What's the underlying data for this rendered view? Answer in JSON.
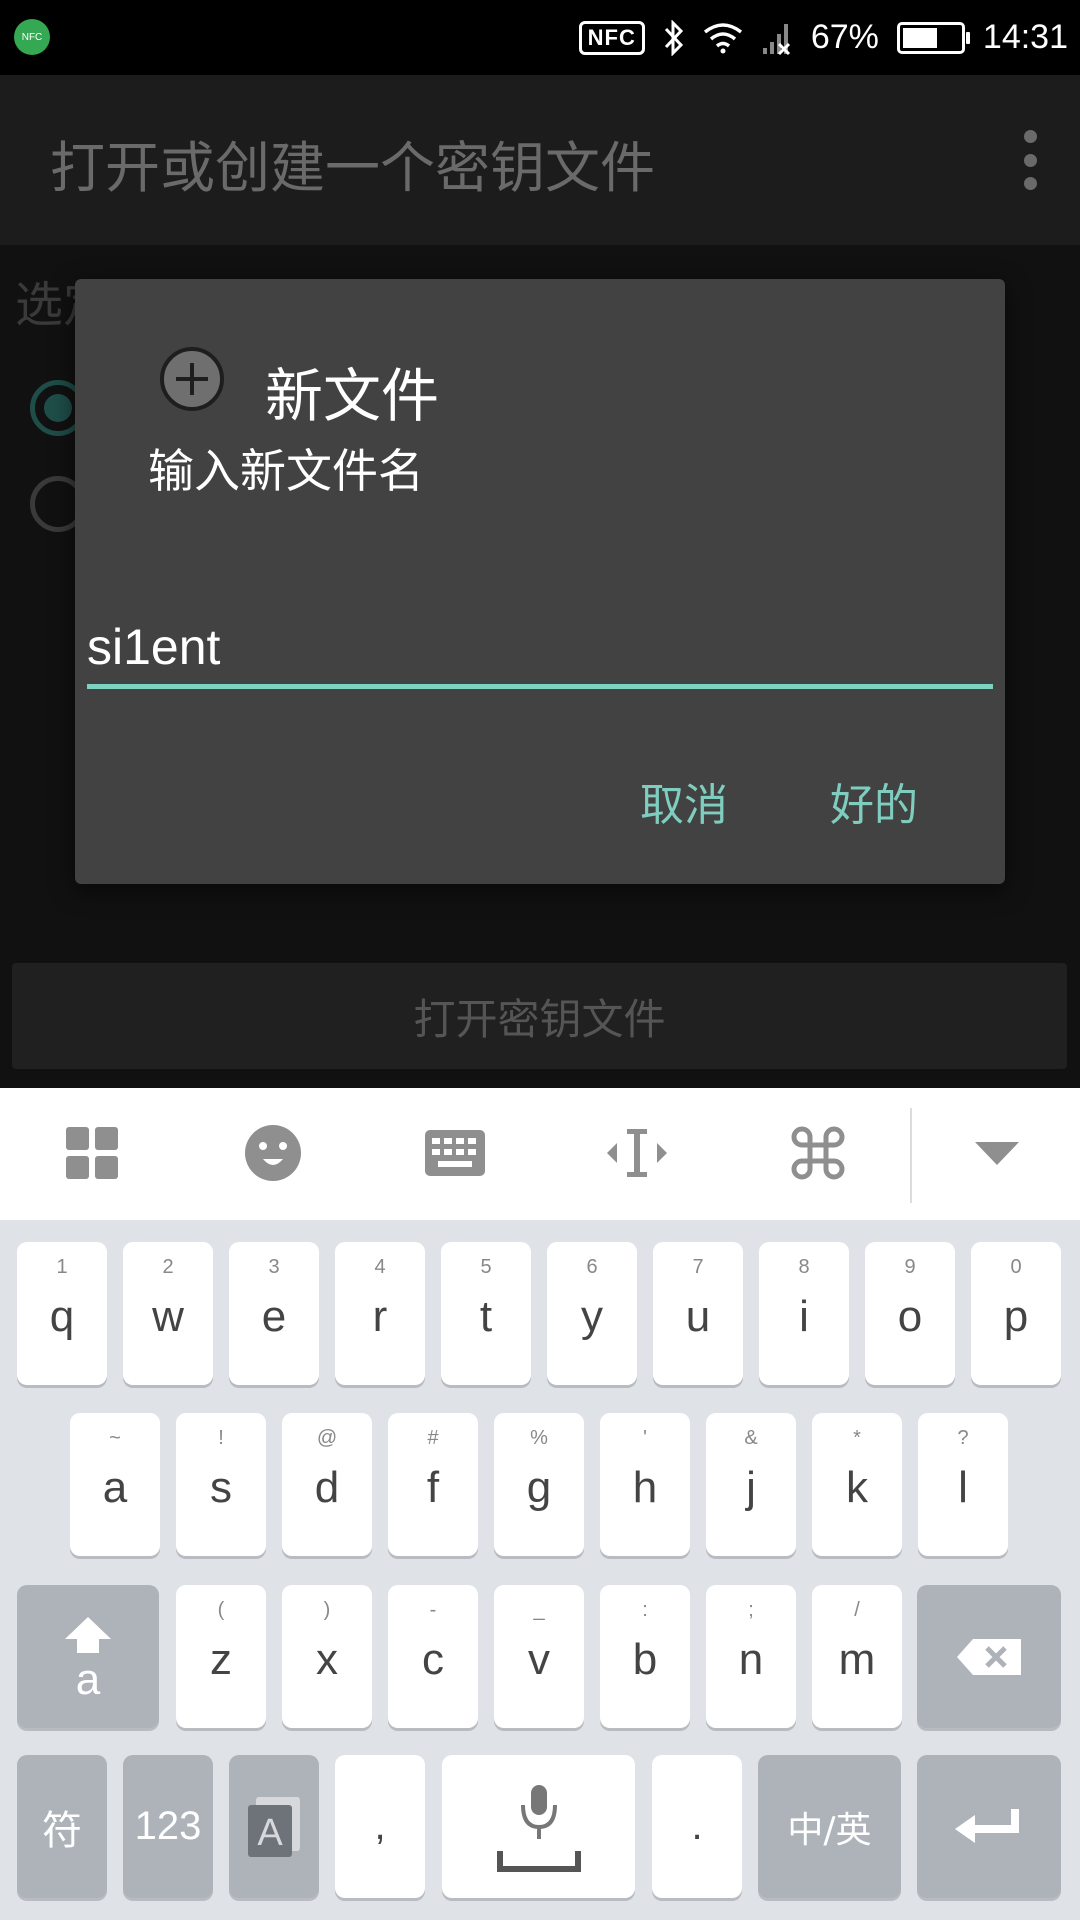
{
  "status_bar": {
    "nfc_badge": "NFC",
    "nfc_box": "NFC",
    "battery_percent": "67%",
    "battery_level": 0.67,
    "time": "14:31"
  },
  "app_bar": {
    "title": "打开或创建一个密钥文件"
  },
  "background": {
    "section_label": "选定一个文件",
    "open_button": "打开密钥文件"
  },
  "dialog": {
    "title": "新文件",
    "message": "输入新文件名",
    "input_value": "si1ent",
    "cancel_label": "取消",
    "ok_label": "好的"
  },
  "keyboard": {
    "row1": [
      {
        "hint": "1",
        "key": "q"
      },
      {
        "hint": "2",
        "key": "w"
      },
      {
        "hint": "3",
        "key": "e"
      },
      {
        "hint": "4",
        "key": "r"
      },
      {
        "hint": "5",
        "key": "t"
      },
      {
        "hint": "6",
        "key": "y"
      },
      {
        "hint": "7",
        "key": "u"
      },
      {
        "hint": "8",
        "key": "i"
      },
      {
        "hint": "9",
        "key": "o"
      },
      {
        "hint": "0",
        "key": "p"
      }
    ],
    "row2": [
      {
        "hint": "~",
        "key": "a"
      },
      {
        "hint": "!",
        "key": "s"
      },
      {
        "hint": "@",
        "key": "d"
      },
      {
        "hint": "#",
        "key": "f"
      },
      {
        "hint": "%",
        "key": "g"
      },
      {
        "hint": "'",
        "key": "h"
      },
      {
        "hint": "&",
        "key": "j"
      },
      {
        "hint": "*",
        "key": "k"
      },
      {
        "hint": "?",
        "key": "l"
      }
    ],
    "row3": [
      {
        "hint": "(",
        "key": "z"
      },
      {
        "hint": ")",
        "key": "x"
      },
      {
        "hint": "-",
        "key": "c"
      },
      {
        "hint": "_",
        "key": "v"
      },
      {
        "hint": ":",
        "key": "b"
      },
      {
        "hint": ";",
        "key": "n"
      },
      {
        "hint": "/",
        "key": "m"
      }
    ],
    "shift_label": "a",
    "symbols_label": "符",
    "numbers_label": "123",
    "comma_label": ",",
    "period_label": ".",
    "lang_label": "中/英"
  },
  "colors": {
    "accent": "#7ed2c2",
    "dialog_bg": "#424242",
    "keyboard_bg": "#dfe2e6"
  }
}
